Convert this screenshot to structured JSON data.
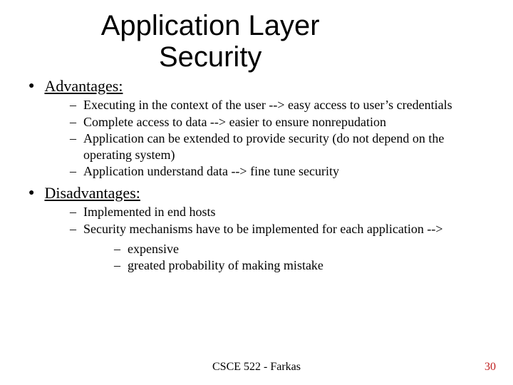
{
  "title_line1": "Application Layer",
  "title_line2": "Security",
  "sections": {
    "advantages": {
      "heading": "Advantages:",
      "items": [
        "Executing in the context of the user --> easy access to user’s credentials",
        "Complete access to data --> easier to ensure nonrepudation",
        "Application can be extended to provide security (do not depend on the operating system)",
        "Application understand data --> fine tune security"
      ]
    },
    "disadvantages": {
      "heading": "Disadvantages:",
      "items": [
        "Implemented in end hosts",
        "Security mechanisms have to be implemented for each application -->"
      ],
      "subitems": [
        "expensive",
        "greated probability of making mistake"
      ]
    }
  },
  "footer": {
    "center": "CSCE 522 - Farkas",
    "page": "30"
  }
}
